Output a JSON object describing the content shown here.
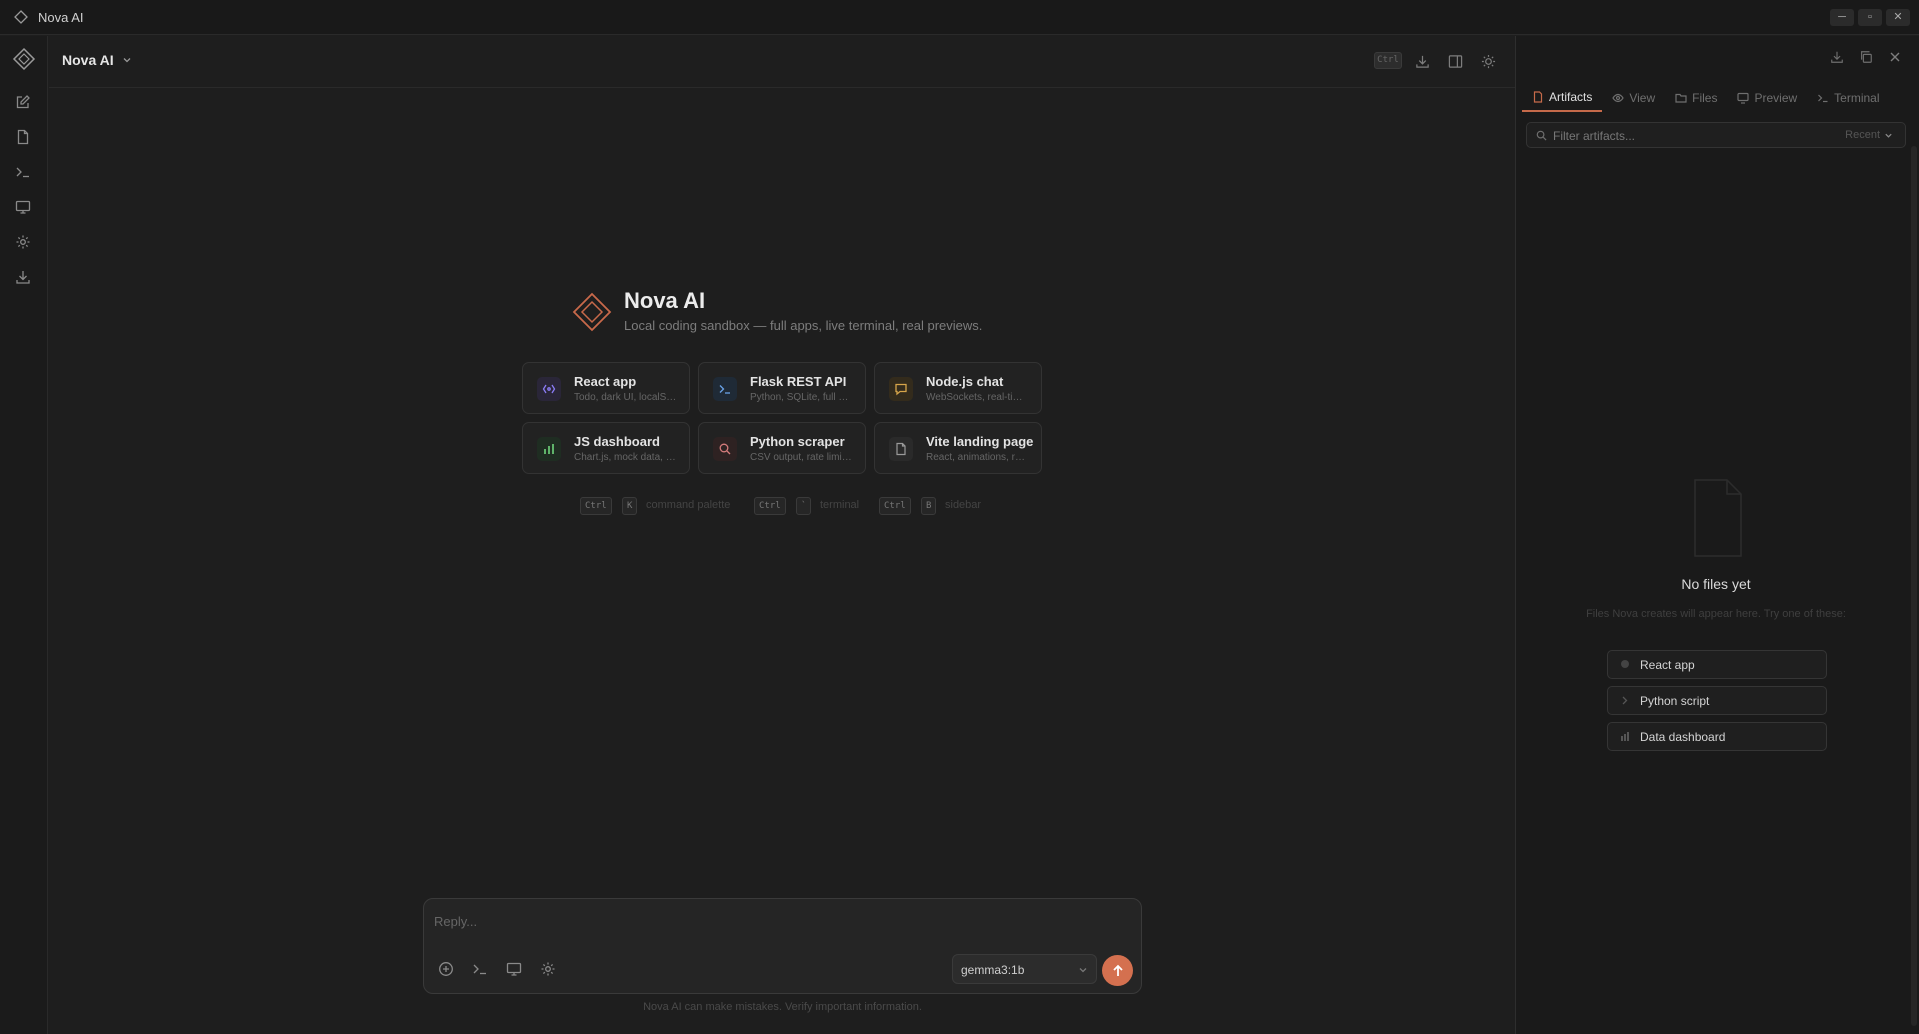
{
  "window": {
    "title": "Nova AI",
    "controls": [
      "─",
      "▫",
      "✕"
    ]
  },
  "header": {
    "workspace_name": "Nova AI",
    "shortcut_hint": "Ctrl"
  },
  "hero": {
    "title": "Nova AI",
    "subtitle": "Local coding sandbox — full apps, live terminal, real previews."
  },
  "starters": [
    {
      "title": "React app",
      "subtitle": "Todo, dark UI, localStorage",
      "icon": "code-brackets-icon",
      "color": "#8b7cf6"
    },
    {
      "title": "Flask REST API",
      "subtitle": "Python, SQLite, full CRUD",
      "icon": "terminal-prompt-icon",
      "color": "#6aa3e8"
    },
    {
      "title": "Node.js chat",
      "subtitle": "WebSockets, real-time rooms",
      "icon": "chat-bubble-icon",
      "color": "#d6a54a"
    },
    {
      "title": "JS dashboard",
      "subtitle": "Chart.js, mock data, filters",
      "icon": "bar-chart-icon",
      "color": "#5fb36a"
    },
    {
      "title": "Python scraper",
      "subtitle": "CSV output, rate limiting",
      "icon": "search-icon",
      "color": "#d47b7b"
    },
    {
      "title": "Vite landing page",
      "subtitle": "React, animations, responsive",
      "icon": "document-icon",
      "color": "#9a9a9a"
    }
  ],
  "shortcuts": [
    {
      "mod": "Ctrl",
      "key": "K",
      "label": "command palette"
    },
    {
      "mod": "Ctrl",
      "key": "`",
      "label": "terminal"
    },
    {
      "mod": "Ctrl",
      "key": "B",
      "label": "sidebar"
    }
  ],
  "composer": {
    "placeholder": "Reply...",
    "model": "gemma3:1b",
    "disclaimer": "Nova AI can make mistakes. Verify important information."
  },
  "panel": {
    "tabs": [
      "Artifacts",
      "View",
      "Files",
      "Preview",
      "Terminal"
    ],
    "active_tab": "Artifacts",
    "filter_placeholder": "Filter artifacts...",
    "sort_label": "Recent",
    "empty_title": "No files yet",
    "empty_subtitle": "Files Nova creates will appear here. Try one of these:",
    "templates": [
      {
        "label": "React app",
        "icon": "dot-icon"
      },
      {
        "label": "Python script",
        "icon": "chevron-right-icon"
      },
      {
        "label": "Data dashboard",
        "icon": "bar-chart-icon"
      }
    ]
  },
  "colors": {
    "accent": "#d4704f",
    "background": "#1e1e1e",
    "panel": "#1a1a1a"
  }
}
